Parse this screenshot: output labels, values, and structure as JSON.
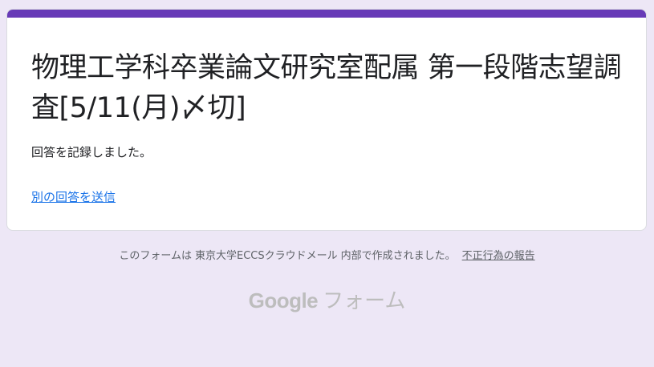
{
  "form": {
    "title": "物理工学科卒業論文研究室配属 第一段階志望調査[5/11(月)〆切]",
    "confirmation_message": "回答を記録しました。",
    "submit_another_link": "別の回答を送信"
  },
  "footer": {
    "created_prefix": "このフォームは",
    "organization": "東京大学ECCSクラウドメール",
    "created_suffix": "内部で作成されました。",
    "report_link": "不正行為の報告"
  },
  "branding": {
    "google": "Google",
    "product": "フォーム"
  },
  "colors": {
    "accent": "#673ab7",
    "background": "#ede7f6",
    "link": "#1a73e8"
  }
}
